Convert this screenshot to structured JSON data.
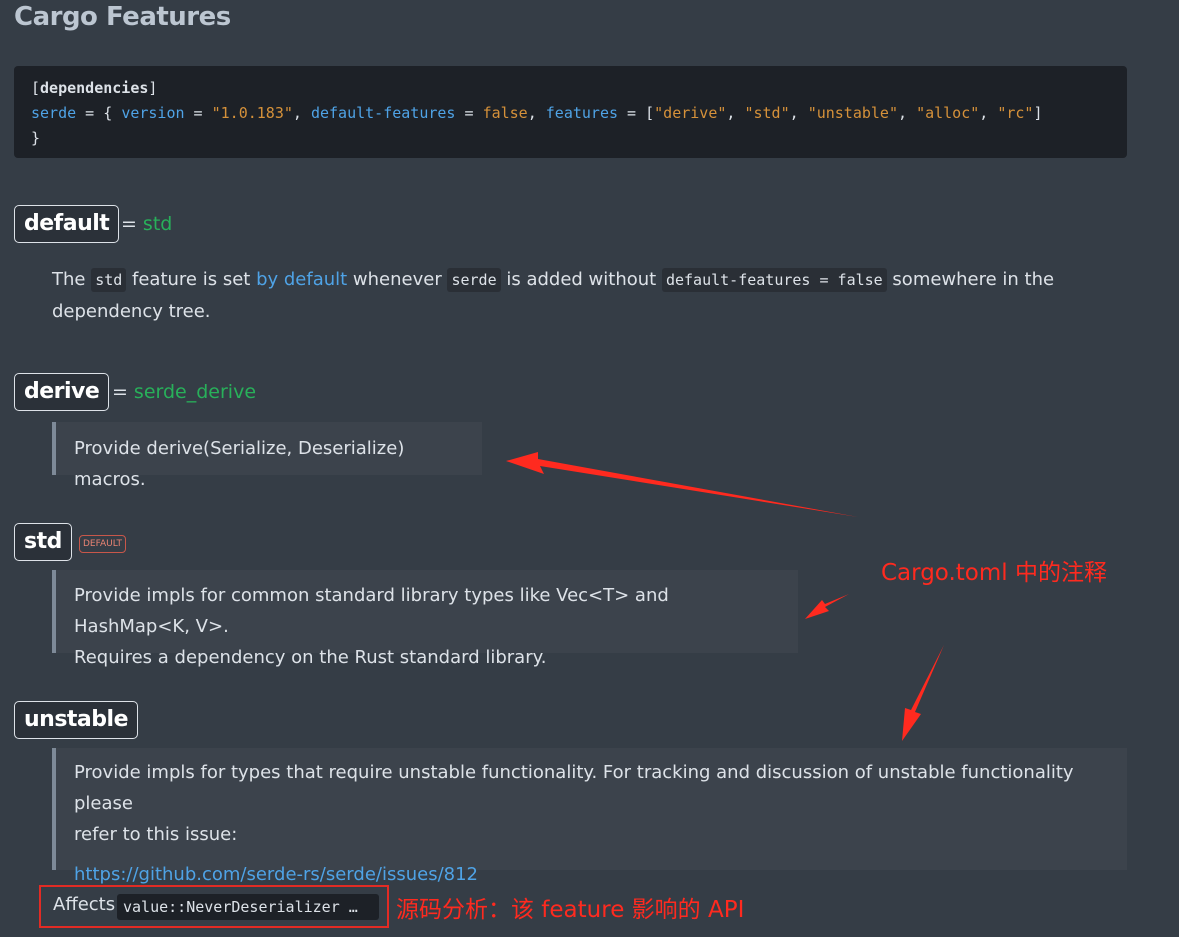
{
  "page_title": "Cargo Features",
  "code": {
    "line1_open": "[",
    "line1_word": "dependencies",
    "line1_close": "]",
    "key_serde": "serde",
    "eq1": " = { ",
    "key_version": "version",
    "eq2": " = ",
    "val_version": "\"1.0.183\"",
    "comma1": ", ",
    "key_default_features": "default-features",
    "eq3": " = ",
    "val_false": "false",
    "comma2": ", ",
    "key_features": "features",
    "eq4": " = [",
    "f1": "\"derive\"",
    "c1": ", ",
    "f2": "\"std\"",
    "c2": ", ",
    "f3": "\"unstable\"",
    "c3": ", ",
    "f4": "\"alloc\"",
    "c4": ", ",
    "f5": "\"rc\"",
    "close_bracket": "]",
    "line3": "}"
  },
  "features": {
    "default": {
      "name": "default",
      "eq": "=",
      "deps": "std",
      "desc_the": "The ",
      "desc_code1": "std",
      "desc_mid1": " feature is set ",
      "desc_link": "by default",
      "desc_mid2": " whenever ",
      "desc_code2": "serde",
      "desc_mid3": " is added without ",
      "desc_code3": "default-features = false",
      "desc_end": " somewhere in the",
      "desc_line2": "dependency tree."
    },
    "derive": {
      "name": "derive",
      "eq": "=",
      "deps": "serde_derive",
      "desc": "Provide derive(Serialize, Deserialize) macros."
    },
    "std": {
      "name": "std",
      "badge": "DEFAULT",
      "desc_line1": "Provide impls for common standard library types like Vec<T> and HashMap<K, V>.",
      "desc_line2": "Requires a dependency on the Rust standard library."
    },
    "unstable": {
      "name": "unstable",
      "desc_line1": "Provide impls for types that require unstable functionality. For tracking and discussion of unstable functionality please",
      "desc_line2": "refer to this issue:",
      "link": "https://github.com/serde-rs/serde/issues/812",
      "affects_label": "Affects",
      "affects_code": "value::NeverDeserializer",
      "affects_more": "…"
    }
  },
  "annotations": {
    "cargo_note": "Cargo.toml 中的注释",
    "api_note": "源码分析：该 feature 影响的 API"
  },
  "colors": {
    "background": "#353d46",
    "code_bg": "#1d2127",
    "accent_link": "#4fa3e6",
    "dep_green": "#28b05a",
    "string_orange": "#d5913a",
    "annotation_red": "#ff2a1f"
  }
}
